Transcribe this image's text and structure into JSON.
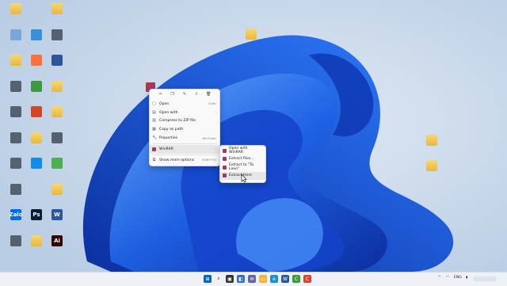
{
  "desktop": {
    "icons": [
      {
        "name": "folder-icon",
        "label": "",
        "kind": "folder"
      },
      {
        "name": "folder-icon",
        "label": "",
        "kind": "folder"
      },
      {
        "name": "recycle-bin-icon",
        "label": "",
        "kind": "app"
      },
      {
        "name": "this-pc-icon",
        "label": "",
        "kind": "app"
      },
      {
        "name": "app-icon",
        "label": "",
        "kind": "app"
      },
      {
        "name": "app-icon",
        "label": "",
        "kind": "app"
      },
      {
        "name": "folder-icon",
        "label": "",
        "kind": "folder"
      },
      {
        "name": "firefox-icon",
        "label": "",
        "kind": "app"
      },
      {
        "name": "word-icon",
        "label": "",
        "kind": "app"
      },
      {
        "name": "app-icon",
        "label": "",
        "kind": "app"
      },
      {
        "name": "camtasia-icon",
        "label": "",
        "kind": "app"
      },
      {
        "name": "app-icon",
        "label": "",
        "kind": "app"
      },
      {
        "name": "powerpoint-icon",
        "label": "",
        "kind": "app"
      },
      {
        "name": "app-icon",
        "label": "",
        "kind": "app"
      },
      {
        "name": "folder-icon",
        "label": "",
        "kind": "folder"
      },
      {
        "name": "app-icon",
        "label": "",
        "kind": "app"
      },
      {
        "name": "app-icon",
        "label": "",
        "kind": "app"
      },
      {
        "name": "teamviewer-icon",
        "label": "",
        "kind": "app"
      },
      {
        "name": "chrome-icon",
        "label": "",
        "kind": "app"
      },
      {
        "name": "app-icon",
        "label": "",
        "kind": "app"
      },
      {
        "name": "folder-icon",
        "label": "",
        "kind": "folder"
      },
      {
        "name": "zalo-icon",
        "label": "Zalo",
        "kind": "app"
      },
      {
        "name": "photoshop-icon",
        "label": "Ps",
        "kind": "app"
      },
      {
        "name": "word-icon",
        "label": "W",
        "kind": "app"
      },
      {
        "name": "app-icon",
        "label": "",
        "kind": "app"
      },
      {
        "name": "folder-icon",
        "label": "",
        "kind": "folder"
      },
      {
        "name": "illustrator-icon",
        "label": "Ai",
        "kind": "app"
      },
      {
        "name": "folder-icon",
        "label": "",
        "kind": "folder"
      },
      {
        "name": "folder-icon",
        "label": "",
        "kind": "folder"
      },
      {
        "name": "folder-icon",
        "label": "",
        "kind": "folder"
      }
    ]
  },
  "context_menu": {
    "toolbar": [
      "cut-icon",
      "copy-icon",
      "rename-icon",
      "share-icon",
      "delete-icon"
    ],
    "items": [
      {
        "label": "Open",
        "shortcut": "Enter"
      },
      {
        "label": "Open with",
        "shortcut": "›"
      },
      {
        "label": "Compress to ZIP file",
        "shortcut": ""
      },
      {
        "label": "Copy as path",
        "shortcut": ""
      },
      {
        "label": "Properties",
        "shortcut": "Alt+Enter"
      },
      {
        "label": "WinRAR",
        "shortcut": "›"
      },
      {
        "label": "Show more options",
        "shortcut": "Shift+F10"
      }
    ]
  },
  "winrar_submenu": {
    "items": [
      {
        "label": "Open with WinRAR"
      },
      {
        "label": "Extract files..."
      },
      {
        "label": "Extract to \"Ta Lieu\\\""
      },
      {
        "label": "Extract Here"
      }
    ]
  },
  "taskbar": {
    "tray_language": "ENG",
    "tray_extra": "^"
  },
  "colors": {
    "accent": "#0067c0",
    "bloom_dark": "#0a2fa8",
    "bloom_light": "#3d8bff"
  }
}
